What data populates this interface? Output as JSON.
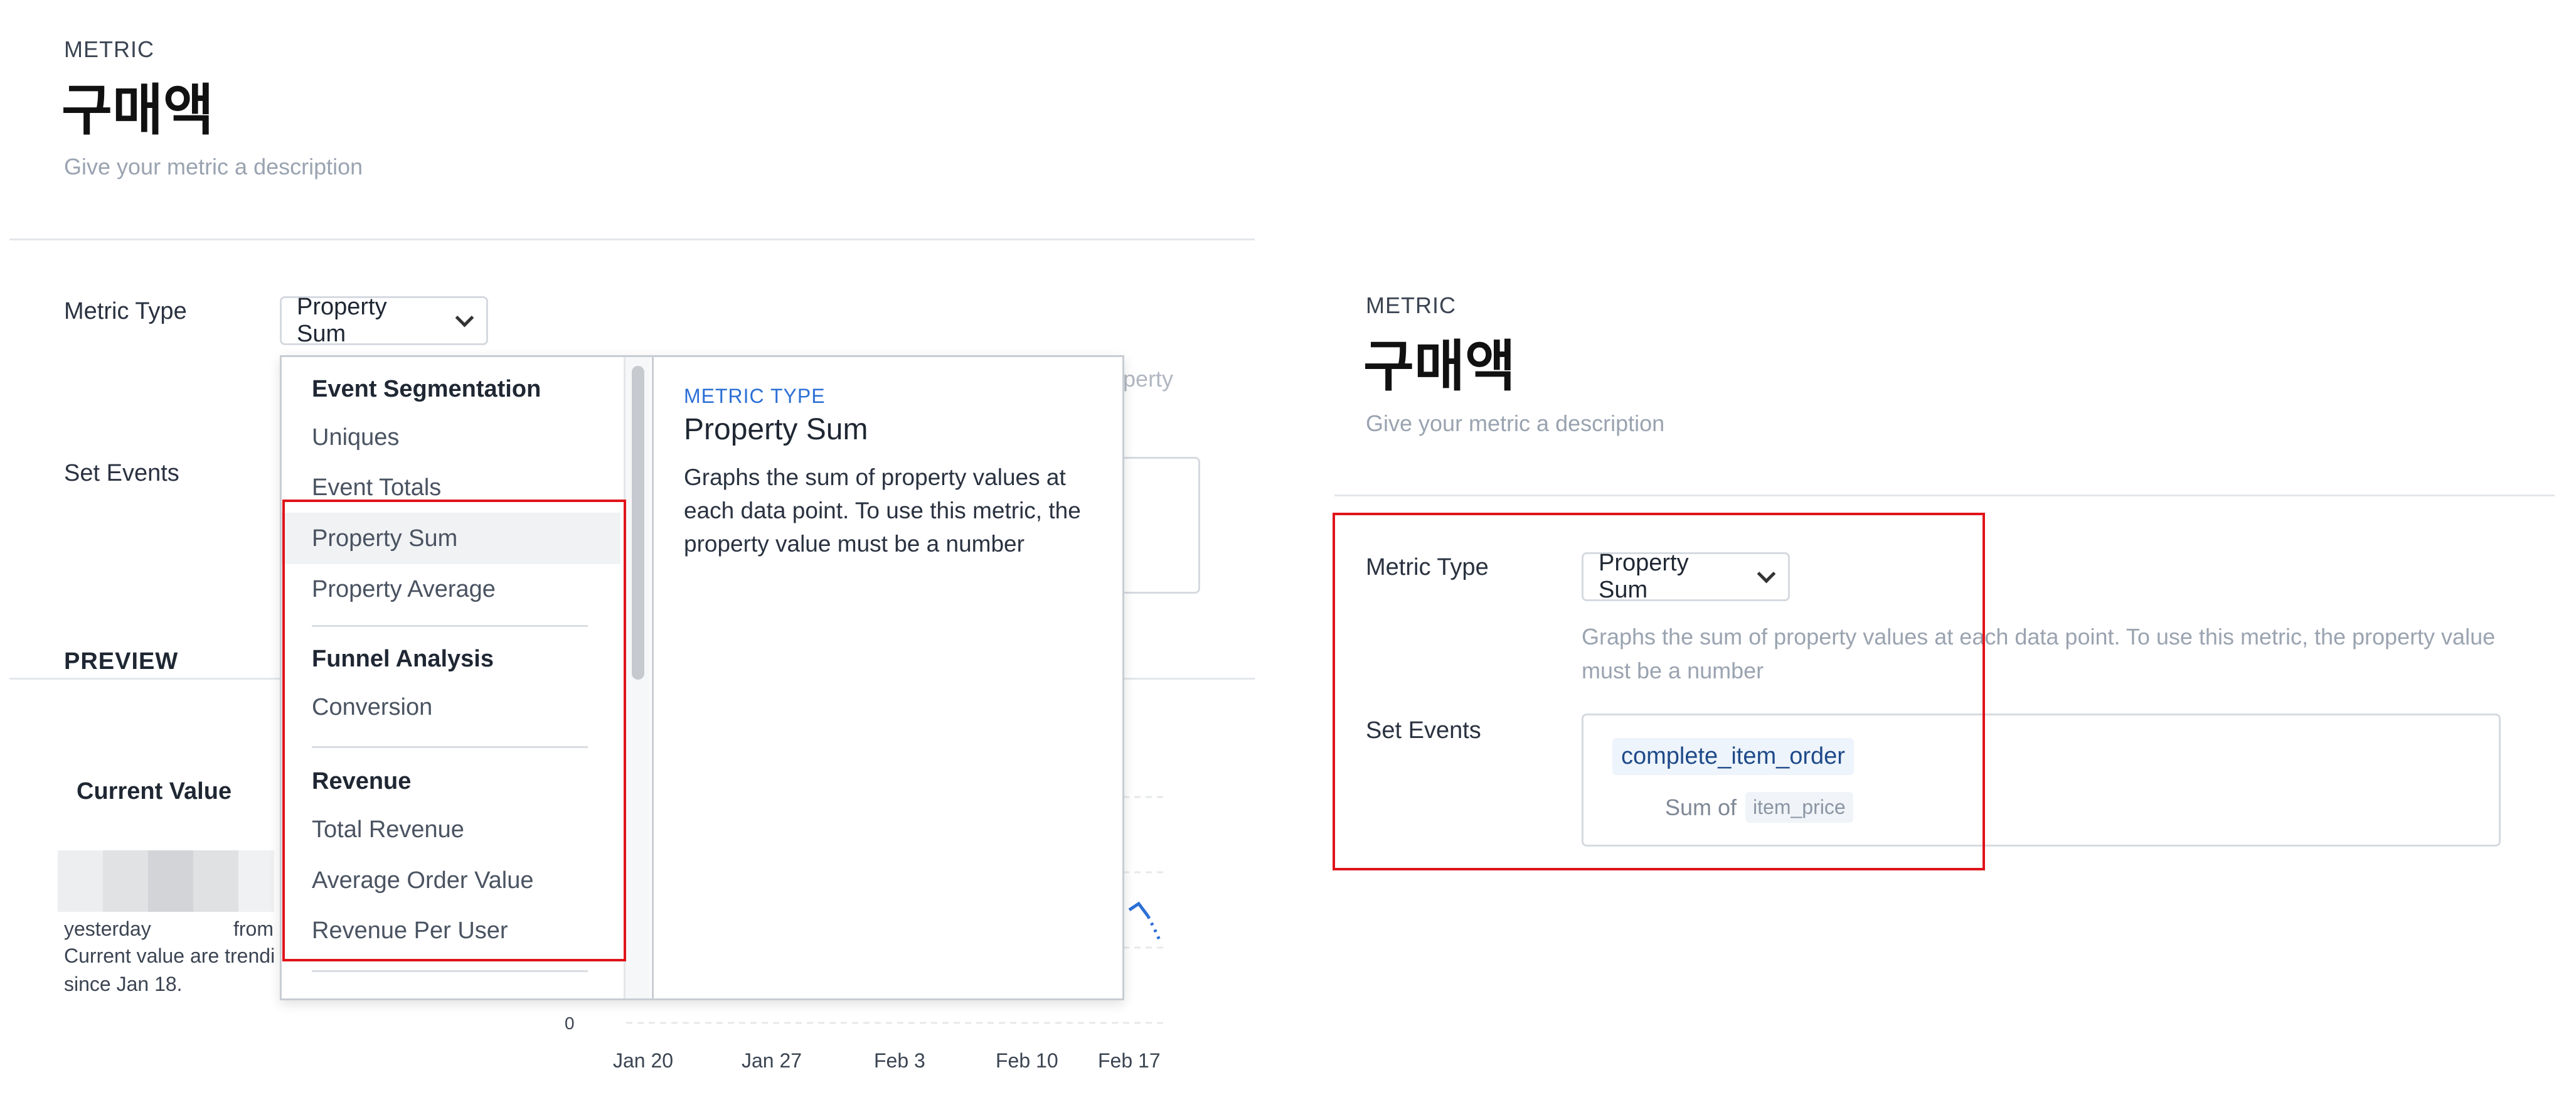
{
  "left": {
    "section_label": "METRIC",
    "title": "구매액",
    "description_placeholder": "Give your metric a description",
    "metric_type_label": "Metric Type",
    "metric_type_value": "Property Sum",
    "set_events_label": "Set Events",
    "preview_label": "PREVIEW",
    "current_value_label": "Current Value",
    "yesterday_text": "yesterday",
    "from_text": "from",
    "trend_text_1": "Current value are trendi",
    "trend_text_2": "since Jan 18.",
    "behind_text": "operty",
    "chart": {
      "y_zero": "0",
      "x_ticks": [
        "Jan 20",
        "Jan 27",
        "Feb 3",
        "Feb 10",
        "Feb 17"
      ]
    },
    "dropdown": {
      "groups": [
        {
          "label": "Event Segmentation",
          "items": [
            "Uniques",
            "Event Totals",
            "Property Sum",
            "Property Average"
          ]
        },
        {
          "label": "Funnel Analysis",
          "items": [
            "Conversion"
          ]
        },
        {
          "label": "Revenue",
          "items": [
            "Total Revenue",
            "Average Order Value",
            "Revenue Per User"
          ]
        }
      ],
      "selected": "Property Sum",
      "panel": {
        "kicker": "METRIC TYPE",
        "title": "Property Sum",
        "body": "Graphs the sum of property values at each data point. To use this metric, the property value must be a number"
      }
    }
  },
  "right": {
    "section_label": "METRIC",
    "title": "구매액",
    "description_placeholder": "Give your metric a description",
    "metric_type_label": "Metric Type",
    "metric_type_value": "Property Sum",
    "metric_type_help": "Graphs the sum of property values at each data point. To use this metric, the property value must be a number",
    "set_events_label": "Set Events",
    "event_name": "complete_item_order",
    "sum_of_label": "Sum of",
    "property_name": "item_price"
  },
  "colors": {
    "highlight_red": "#e0131a",
    "accent_blue": "#2b6fd6"
  }
}
